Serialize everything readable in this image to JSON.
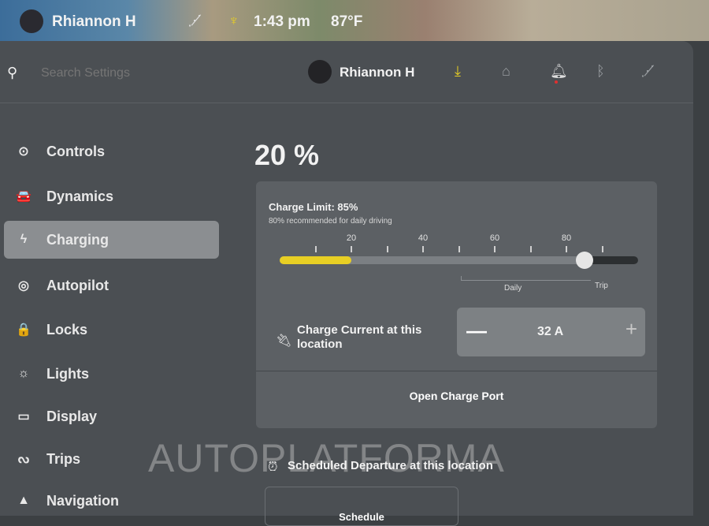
{
  "status_bar": {
    "user": "Rhiannon H",
    "time": "1:43 pm",
    "temperature": "87°F",
    "icons": [
      "no-signal-icon",
      "sentry-icon"
    ]
  },
  "header": {
    "search_placeholder": "Search Settings",
    "user": "Rhiannon H",
    "icons": [
      "download-icon",
      "garage-icon",
      "bell-icon",
      "bluetooth-icon",
      "no-signal-icon"
    ],
    "accent": "#e8cf24",
    "notification_color": "#e03030"
  },
  "sidebar": {
    "items": [
      {
        "label": "Controls",
        "icon": "toggle-icon",
        "icon_char": "⊙"
      },
      {
        "label": "Dynamics",
        "icon": "car-icon",
        "icon_char": "🚘"
      },
      {
        "label": "Charging",
        "icon": "bolt-icon",
        "icon_char": "ϟ",
        "selected": true
      },
      {
        "label": "Autopilot",
        "icon": "steering-wheel-icon",
        "icon_char": "◎"
      },
      {
        "label": "Locks",
        "icon": "lock-icon",
        "icon_char": "🔒"
      },
      {
        "label": "Lights",
        "icon": "sun-icon",
        "icon_char": "☼"
      },
      {
        "label": "Display",
        "icon": "display-icon",
        "icon_char": "▭"
      },
      {
        "label": "Trips",
        "icon": "trips-icon",
        "icon_char": "ᔓ"
      },
      {
        "label": "Navigation",
        "icon": "navigation-icon",
        "icon_char": "▲"
      }
    ]
  },
  "charging": {
    "battery_level": "20 %",
    "battery_level_value": 20,
    "charge_limit_label": "Charge Limit: 85%",
    "charge_limit_value": 85,
    "recommendation": "80% recommended for daily driving",
    "tick_labels": [
      "20",
      "40",
      "60",
      "80"
    ],
    "daily_label": "Daily",
    "trip_label": "Trip",
    "charge_current_label": "Charge Current at this location",
    "minus": "—",
    "charge_current": "32 A",
    "plus": "+",
    "open_charge_port": "Open Charge Port",
    "scheduled_departure": "Scheduled Departure at this location",
    "schedule_button": "Schedule"
  },
  "watermark": "AUTOPLATFORMA"
}
